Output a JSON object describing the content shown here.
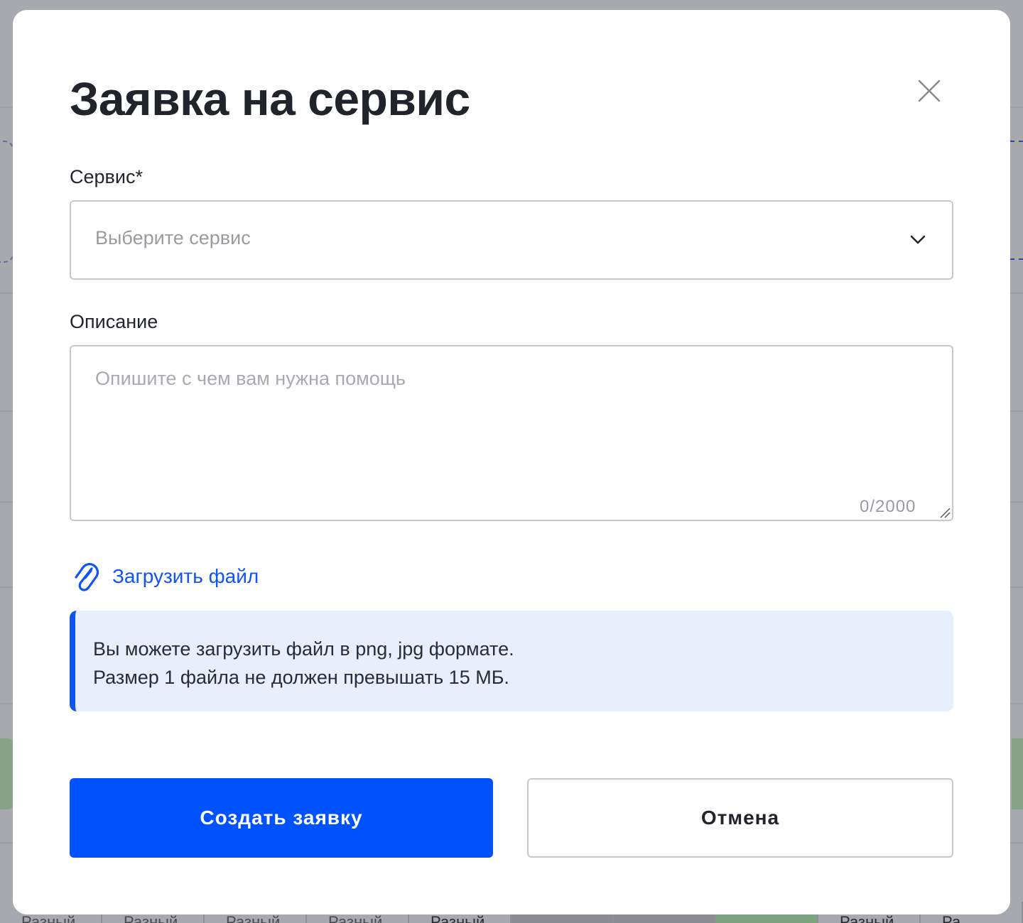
{
  "modal": {
    "title": "Заявка на сервис",
    "service_label": "Сервис*",
    "service_placeholder": "Выберите сервис",
    "description_label": "Описание",
    "description_placeholder": "Опишите с чем вам нужна помощь",
    "char_counter": "0/2000",
    "upload_label": "Загрузить файл",
    "info_lines": [
      "Вы можете загрузить файл в png, jpg формате.",
      "Размер 1 файла не должен превышать 15 МБ."
    ],
    "submit_label": "Создать заявку",
    "cancel_label": "Отмена"
  },
  "background": {
    "bottom_row_cells": [
      "Разный",
      "Разный",
      "Разный",
      "Разный",
      "Разный",
      "",
      "",
      "",
      "Разный",
      "Ра"
    ]
  },
  "colors": {
    "accent": "#0052ff",
    "link": "#1154f0",
    "info_bg": "#e7eefc",
    "overlay": "#a8a9ae"
  },
  "icons": {
    "close": "close-icon",
    "chevron": "chevron-down-icon",
    "attach": "paperclip-icon"
  }
}
